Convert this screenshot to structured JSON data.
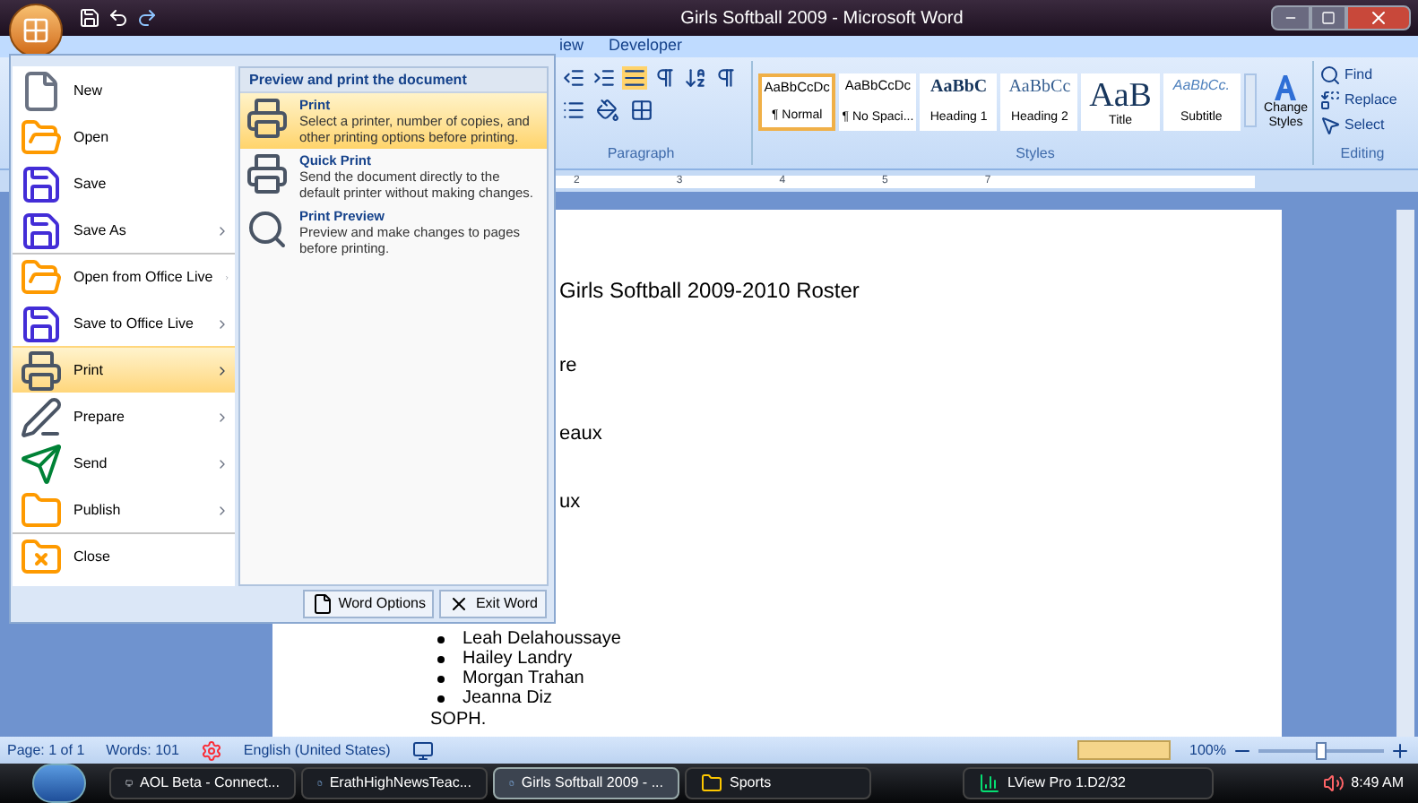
{
  "window": {
    "title": "Girls Softball 2009 - Microsoft Word"
  },
  "ribbon_tabs": [
    {
      "label": "iew"
    },
    {
      "label": "Developer"
    }
  ],
  "ribbon": {
    "paragraph_label": "Paragraph",
    "styles_label": "Styles",
    "editing_label": "Editing",
    "styles": [
      {
        "sample": "AaBbCcDc",
        "name": "¶ Normal",
        "kind": "plain",
        "selected": true
      },
      {
        "sample": "AaBbCcDc",
        "name": "¶ No Spaci...",
        "kind": "plain",
        "selected": false
      },
      {
        "sample": "AaBbC",
        "name": "Heading 1",
        "kind": "heading1",
        "selected": false
      },
      {
        "sample": "AaBbCc",
        "name": "Heading 2",
        "kind": "heading2",
        "selected": false
      },
      {
        "sample": "AaB",
        "name": "Title",
        "kind": "title",
        "selected": false
      },
      {
        "sample": "AaBbCc.",
        "name": "Subtitle",
        "kind": "subtitle",
        "selected": false
      }
    ],
    "change_styles": "Change Styles",
    "editing": [
      {
        "label": "Find",
        "kind": "find"
      },
      {
        "label": "Replace",
        "kind": "replace"
      },
      {
        "label": "Select",
        "kind": "select"
      }
    ]
  },
  "ruler": [
    "2",
    "3",
    "4",
    "5",
    "7"
  ],
  "document": {
    "title": "Girls Softball 2009-2010 Roster",
    "fragments": [
      "re",
      "eaux",
      "ux"
    ],
    "bullets": [
      "Leah Delahoussaye",
      "Hailey Landry",
      "Morgan Trahan",
      "Jeanna Diz"
    ],
    "trailing": "SOPH."
  },
  "office_menu": {
    "items": [
      {
        "label": "New",
        "kind": "new",
        "submenu": false,
        "selected": false,
        "separator_before": false
      },
      {
        "label": "Open",
        "kind": "open",
        "submenu": false,
        "selected": false,
        "separator_before": false
      },
      {
        "label": "Save",
        "kind": "save",
        "submenu": false,
        "selected": false,
        "separator_before": false
      },
      {
        "label": "Save As",
        "kind": "saveas",
        "submenu": true,
        "selected": false,
        "separator_before": false
      },
      {
        "label": "Open from Office Live",
        "kind": "open",
        "submenu": true,
        "selected": false,
        "separator_before": true
      },
      {
        "label": "Save to Office Live",
        "kind": "save",
        "submenu": true,
        "selected": false,
        "separator_before": false
      },
      {
        "label": "Print",
        "kind": "print",
        "submenu": true,
        "selected": true,
        "separator_before": false
      },
      {
        "label": "Prepare",
        "kind": "prepare",
        "submenu": true,
        "selected": false,
        "separator_before": false
      },
      {
        "label": "Send",
        "kind": "send",
        "submenu": true,
        "selected": false,
        "separator_before": false
      },
      {
        "label": "Publish",
        "kind": "publish",
        "submenu": true,
        "selected": false,
        "separator_before": false
      },
      {
        "label": "Close",
        "kind": "close",
        "submenu": false,
        "selected": false,
        "separator_before": true
      }
    ],
    "pane_title": "Preview and print the document",
    "pane_items": [
      {
        "title": "Print",
        "description": "Select a printer, number of copies, and other printing options before printing.",
        "kind": "print",
        "selected": true
      },
      {
        "title": "Quick Print",
        "description": "Send the document directly to the default printer without making changes.",
        "kind": "quickprint",
        "selected": false
      },
      {
        "title": "Print Preview",
        "description": "Preview and make changes to pages before printing.",
        "kind": "preview",
        "selected": false
      }
    ],
    "buttons": [
      {
        "label": "Word Options",
        "kind": "options"
      },
      {
        "label": "Exit Word",
        "kind": "exit"
      }
    ]
  },
  "status_bar": {
    "page": "Page: 1 of 1",
    "words": "Words: 101",
    "language": "English (United States)",
    "zoom": "100%",
    "level": 0.5
  },
  "taskbar": {
    "items": [
      {
        "label": "AOL Beta - Connect...",
        "kind": "aol",
        "selected": false
      },
      {
        "label": "ErathHighNewsTeac...",
        "kind": "word",
        "selected": false
      },
      {
        "label": "Girls Softball 2009 - ...",
        "kind": "word",
        "selected": true
      },
      {
        "label": "Sports",
        "kind": "folder",
        "selected": false
      },
      {
        "label": "LView Pro 1.D2/32",
        "kind": "chart",
        "selected": false
      }
    ],
    "clock": "8:49 AM"
  }
}
